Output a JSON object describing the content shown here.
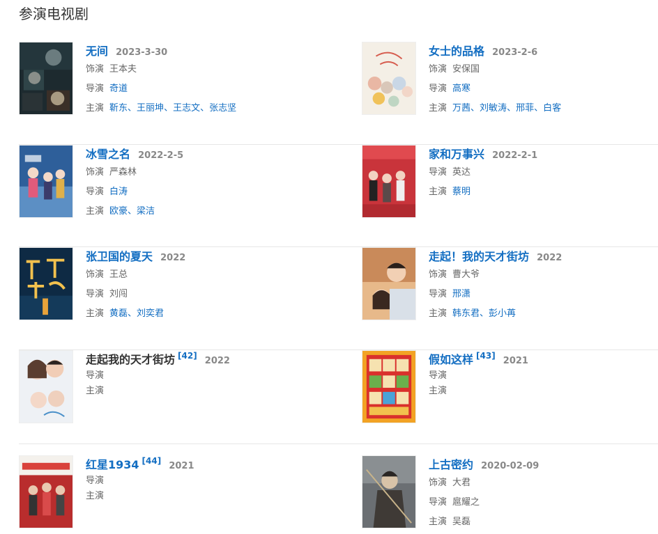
{
  "section": {
    "title": "参演电视剧"
  },
  "labels": {
    "role": "饰演",
    "director": "导演",
    "cast": "主演",
    "sep": "、"
  },
  "items": [
    {
      "title": "无间",
      "date": "2023-3-30",
      "role": "王本夫",
      "director": "奇道",
      "cast": [
        "靳东",
        "王丽坤",
        "王志文",
        "张志坚"
      ]
    },
    {
      "title": "女士的品格",
      "date": "2023-2-6",
      "role": "安保国",
      "director": "高寒",
      "cast": [
        "万茜",
        "刘敏涛",
        "邢菲",
        "白客"
      ]
    },
    {
      "title": "冰雪之名",
      "date": "2022-2-5",
      "role": "严森林",
      "director": "白涛",
      "cast": [
        "欧豪",
        "梁洁"
      ]
    },
    {
      "title": "家和万事兴",
      "date": "2022-2-1",
      "director": "英达",
      "cast": [
        "蔡明"
      ]
    },
    {
      "title": "张卫国的夏天",
      "date": "2022",
      "role": "王总",
      "director": "刘闯",
      "cast": [
        "黄磊",
        "刘奕君"
      ]
    },
    {
      "title": "走起！我的天才街坊",
      "date": "2022",
      "role": "曹大爷",
      "director": "邢潇",
      "cast": [
        "韩东君",
        "彭小苒"
      ]
    },
    {
      "title": "走起我的天才街坊",
      "cite": "[42]",
      "date": "2022"
    },
    {
      "title": "假如这样",
      "cite": "[43]",
      "date": "2021"
    },
    {
      "title": "红星1934",
      "cite": "[44]",
      "date": "2021"
    },
    {
      "title": "上古密约",
      "date": "2020-02-09",
      "role": "大君",
      "director": "扈耀之",
      "cast": [
        "吴磊"
      ]
    }
  ],
  "colors": {
    "link": "#136ec2",
    "label": "#666666",
    "date": "#888888",
    "divider": "#e6e6e6"
  },
  "icons": [
    "poster-image"
  ]
}
